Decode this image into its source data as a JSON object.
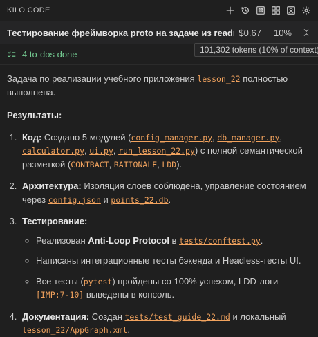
{
  "app": {
    "title": "KILO CODE"
  },
  "toolbar_icons": [
    "plus-icon",
    "history-icon",
    "marketplace-icon",
    "modes-icon",
    "account-icon",
    "settings-icon"
  ],
  "task": {
    "title": "Тестирование фреймворка proto на задаче из readme",
    "cost": "$0.67",
    "context_percent": "10%",
    "tooltip": "101,302 tokens (10% of context)"
  },
  "todos": {
    "label": "4 to-dos done"
  },
  "message": {
    "intro_before": "Задача по реализации учебного приложения ",
    "intro_code": "lesson_22",
    "intro_after": " полностью выполнена.",
    "results_heading": "Результаты:",
    "items": {
      "i1": {
        "label": "Код:",
        "t1": " Создано 5 модулей (",
        "c1": "config_manager.py",
        "t2": ", ",
        "c2": "db_manager.py",
        "t3": ", ",
        "c3": "calculator.py",
        "t4": ", ",
        "c4": "ui.py",
        "t5": ", ",
        "c5": "run_lesson_22.py",
        "t6": ") с полной семантической разметкой (",
        "c6": "CONTRACT",
        "t7": ", ",
        "c7": "RATIONALE",
        "t8": ", ",
        "c8": "LDD",
        "t9": ")."
      },
      "i2": {
        "label": "Архитектура:",
        "t1": " Изоляция слоев соблюдена, управление состоянием через ",
        "c1": "config.json",
        "t2": " и ",
        "c2": "points_22.db",
        "t3": "."
      },
      "i3": {
        "label": "Тестирование:",
        "sub1": {
          "t1": "Реализован ",
          "b1": "Anti-Loop Protocol",
          "t2": " в ",
          "c1": "tests/conftest.py",
          "t3": "."
        },
        "sub2": {
          "t1": "Написаны интеграционные тесты бэкенда и Headless-тесты UI."
        },
        "sub3": {
          "t1": "Все тесты (",
          "c1": "pytest",
          "t2": ") пройдены со 100% успехом, LDD-логи ",
          "c2": "[IMP:7-10]",
          "t3": " выведены в консоль."
        }
      },
      "i4": {
        "label": "Документация:",
        "t1": " Создан ",
        "c1": "tests/test_guide_22.md",
        "t2": " и локальный ",
        "c2": "lesson_22/AppGraph.xml",
        "t3": "."
      }
    }
  },
  "colors": {
    "background": "#1f1f1f",
    "code": "#f2a35e",
    "todos": "#73c991"
  }
}
